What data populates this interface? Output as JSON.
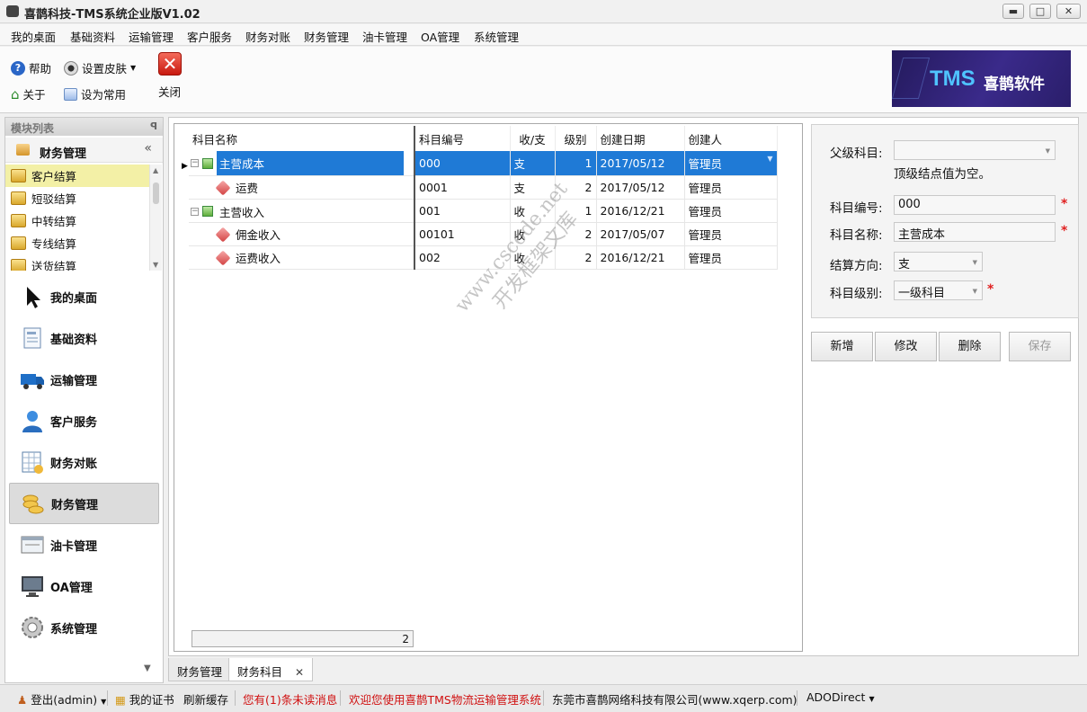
{
  "window": {
    "title": "喜鹊科技-TMS系统企业版V1.02"
  },
  "menu": [
    "我的桌面",
    "基础资料",
    "运输管理",
    "客户服务",
    "财务对账",
    "财务管理",
    "油卡管理",
    "OA管理",
    "系统管理"
  ],
  "toolbar": {
    "help": "帮助",
    "skin": "设置皮肤",
    "about": "关于",
    "set_common": "设为常用",
    "close": "关闭"
  },
  "logo": {
    "brand": "TMS",
    "name": "喜鹊软件"
  },
  "left_panel": {
    "header": "模块列表",
    "group": "财务管理",
    "sub_items": [
      "客户结算",
      "短驳结算",
      "中转结算",
      "专线结算",
      "送货结算"
    ],
    "nav": [
      "我的桌面",
      "基础资料",
      "运输管理",
      "客户服务",
      "财务对账",
      "财务管理",
      "油卡管理",
      "OA管理",
      "系统管理"
    ],
    "selected_nav": "财务管理"
  },
  "grid": {
    "columns": [
      "科目名称",
      "科目编号",
      "收/支",
      "级别",
      "创建日期",
      "创建人"
    ],
    "rows": [
      {
        "name": "主营成本",
        "code": "000",
        "dir": "支",
        "level": "1",
        "date": "2017/05/12",
        "creator": "管理员"
      },
      {
        "name": "运费",
        "code": "0001",
        "dir": "支",
        "level": "2",
        "date": "2017/05/12",
        "creator": "管理员"
      },
      {
        "name": "主营收入",
        "code": "001",
        "dir": "收",
        "level": "1",
        "date": "2016/12/21",
        "creator": "管理员"
      },
      {
        "name": "佣金收入",
        "code": "00101",
        "dir": "收",
        "level": "2",
        "date": "2017/05/07",
        "creator": "管理员"
      },
      {
        "name": "运费收入",
        "code": "002",
        "dir": "收",
        "level": "2",
        "date": "2016/12/21",
        "creator": "管理员"
      }
    ],
    "footer_count": "2"
  },
  "watermark": {
    "line1": "www.cscode.net",
    "line2": "开发框架文库"
  },
  "form": {
    "parent_label": "父级科目:",
    "parent_value": "",
    "parent_hint": "顶级结点值为空。",
    "code_label": "科目编号:",
    "code_value": "000",
    "name_label": "科目名称:",
    "name_value": "主营成本",
    "dir_label": "结算方向:",
    "dir_value": "支",
    "level_label": "科目级别:",
    "level_value": "一级科目",
    "required_mark": "*"
  },
  "actions": {
    "add": "新增",
    "edit": "修改",
    "delete": "删除",
    "save": "保存"
  },
  "tabs": [
    "财务管理",
    "财务科目"
  ],
  "status": {
    "login": "登出(admin)",
    "cert": "我的证书",
    "refresh": "刷新缓存",
    "unread": "您有(1)条未读消息",
    "welcome": "欢迎您使用喜鹊TMS物流运输管理系统",
    "company": "东莞市喜鹊网络科技有限公司(www.xqerp.com)",
    "db": "ADODirect"
  },
  "colors": {
    "selection": "#1f7ad6",
    "required": "#e02020",
    "status_red": "#d01010"
  }
}
